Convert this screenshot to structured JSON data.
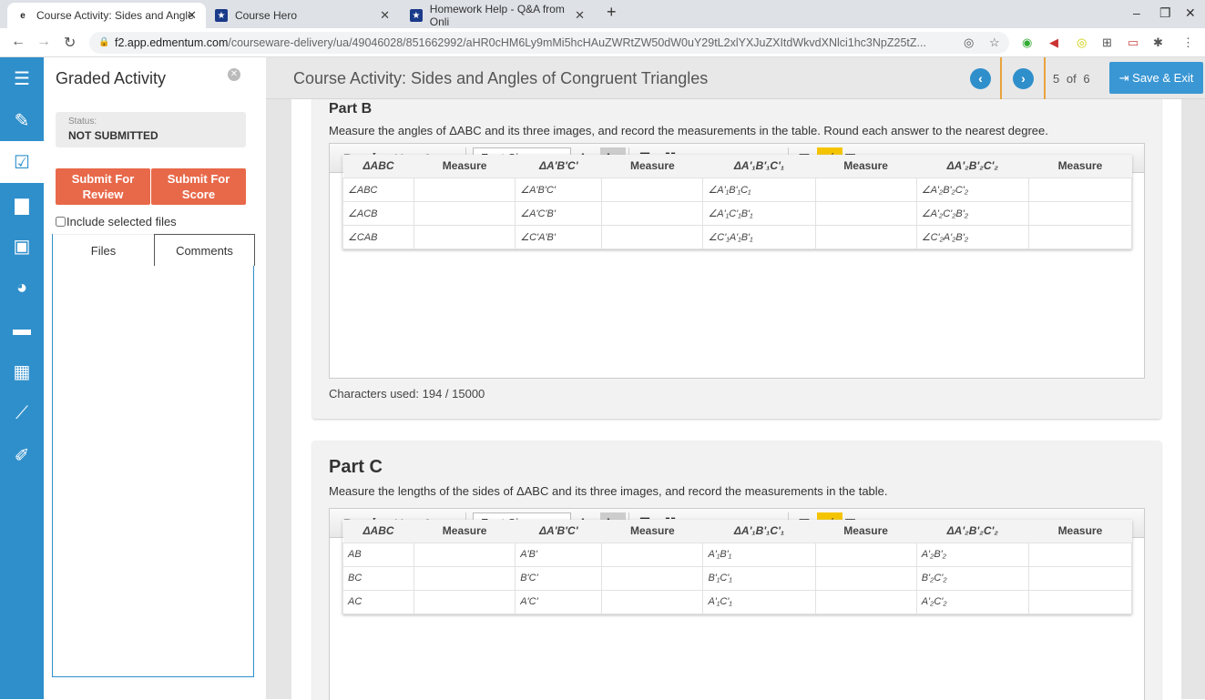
{
  "browser": {
    "tabs": [
      {
        "title": "Course Activity: Sides and Angle",
        "active": true
      },
      {
        "title": "Course Hero"
      },
      {
        "title": "Homework Help - Q&A from Onli"
      }
    ],
    "url_domain": "f2.app.edmentum.com",
    "url_path": "/courseware-delivery/ua/49046028/851662992/aHR0cHM6Ly9mMi5hcHAuZWRtZW50dW0uY29tL2xlYXJuZXItdWkvdXNlci1hc3NpZ25tZ..."
  },
  "sidebar": {
    "title": "Graded Activity",
    "status_label": "Status:",
    "status_value": "NOT SUBMITTED",
    "submit_review": "Submit For Review",
    "submit_score": "Submit For Score",
    "include_files": "Include selected files",
    "tabs": [
      "Files",
      "Comments"
    ]
  },
  "header": {
    "title": "Course Activity: Sides and Angles of Congruent Triangles",
    "page_current": "5",
    "page_of": "of",
    "page_total": "6",
    "save_exit": "Save & Exit"
  },
  "toolbar": {
    "font_sizes": "Font Sizes"
  },
  "part_b": {
    "title": "Part B",
    "description": "Measure the angles of ΔABC and its three images, and record the measurements in the table. Round each answer to the nearest degree.",
    "headers": [
      "ΔABC",
      "Measure",
      "ΔA'B'C'",
      "Measure",
      "ΔA'₁B'₁C'₁",
      "Measure",
      "ΔA'₂B'₂C'₂",
      "Measure"
    ],
    "rows": [
      [
        "∠ABC",
        "",
        "∠A'B'C'",
        "",
        "∠A'₁B'₁C₁",
        "",
        "∠A'₂B'₂C'₂",
        ""
      ],
      [
        "∠ACB",
        "",
        "∠A'C'B'",
        "",
        "∠A'₁C'₁B'₁",
        "",
        "∠A'₂C'₂B'₂",
        ""
      ],
      [
        "∠CAB",
        "",
        "∠C'A'B'",
        "",
        "∠C'₁A'₁B'₁",
        "",
        "∠C'₂A'₂B'₂",
        ""
      ]
    ],
    "chars_used": "Characters used: 194 / 15000"
  },
  "part_c": {
    "title": "Part C",
    "description": "Measure the lengths of the sides of ΔABC and its three images, and record the measurements in the table.",
    "headers": [
      "ΔABC",
      "Measure",
      "ΔA'B'C'",
      "Measure",
      "ΔA'₁B'₁C'₁",
      "Measure",
      "ΔA'₂B'₂C'₂",
      "Measure"
    ],
    "rows": [
      [
        "AB",
        "",
        "A'B'",
        "",
        "A'₁B'₁",
        "",
        "A'₂B'₂",
        ""
      ],
      [
        "BC",
        "",
        "B'C'",
        "",
        "B'₁C'₁",
        "",
        "B'₂C'₂",
        ""
      ],
      [
        "AC",
        "",
        "A'C'",
        "",
        "A'₁C'₁",
        "",
        "A'₂C'₂",
        ""
      ]
    ]
  },
  "colors": {
    "rail": "#2f8fcb",
    "submit": "#e8694a",
    "save": "#3a97d4",
    "highlight": "#e8a33d"
  }
}
